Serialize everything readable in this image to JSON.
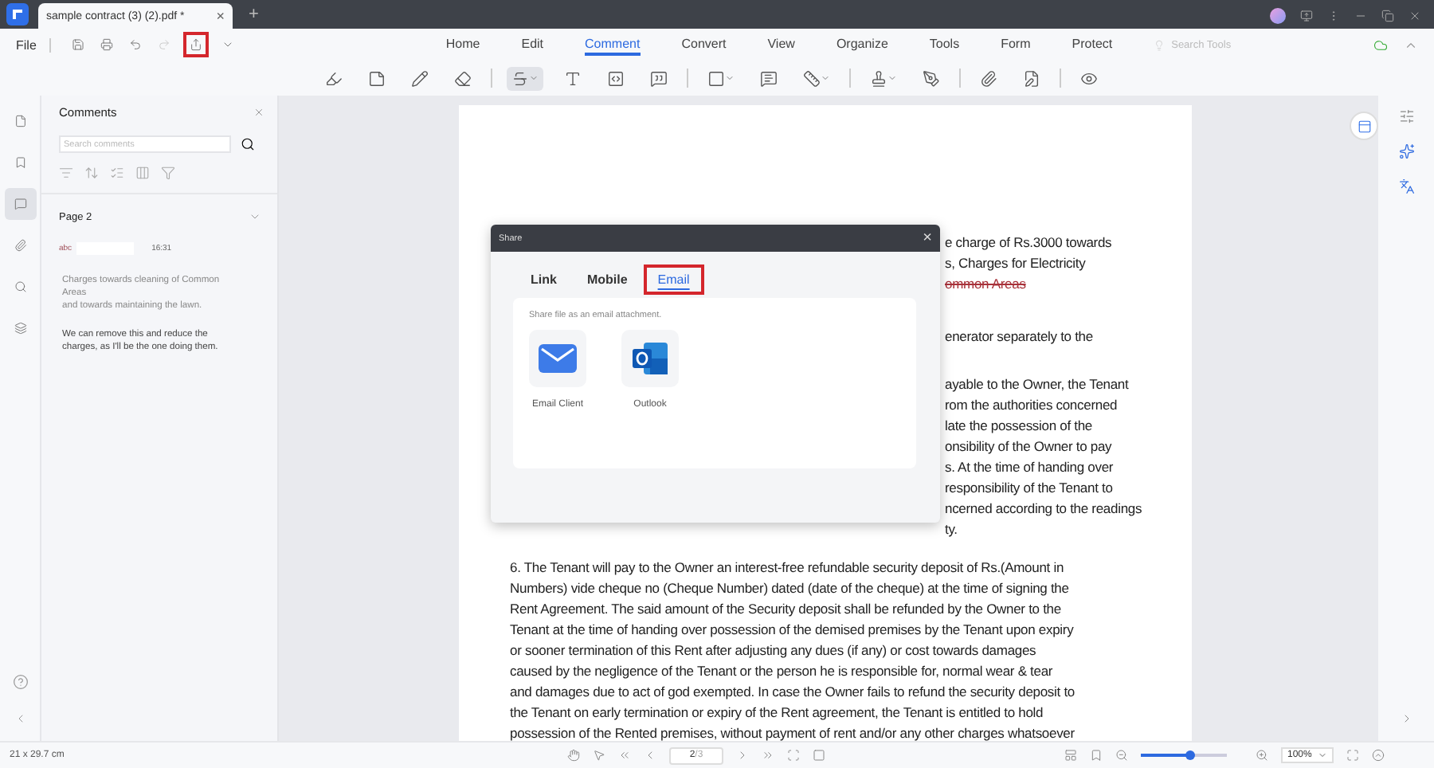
{
  "title_bar": {
    "tab": {
      "title": "sample contract (3) (2).pdf *",
      "close": "×"
    },
    "new_tab": "+"
  },
  "quick_access": {
    "file": "File",
    "share_highlighted": true
  },
  "nav_tabs": [
    {
      "label": "Home",
      "selected": false
    },
    {
      "label": "Edit",
      "selected": false
    },
    {
      "label": "Comment",
      "selected": true
    },
    {
      "label": "Convert",
      "selected": false
    },
    {
      "label": "View",
      "selected": false
    },
    {
      "label": "Organize",
      "selected": false
    },
    {
      "label": "Tools",
      "selected": false
    },
    {
      "label": "Form",
      "selected": false
    },
    {
      "label": "Protect",
      "selected": false
    }
  ],
  "search_tools": {
    "placeholder": "Search Tools"
  },
  "tools": [
    {
      "active": false
    },
    {
      "active": false
    },
    {
      "active": false
    },
    {
      "active": false
    },
    {
      "active": true
    },
    {
      "active": false
    },
    {
      "active": false
    },
    {
      "active": false
    },
    {
      "active": false
    },
    {
      "active": false
    },
    {
      "active": false
    },
    {
      "active": false
    },
    {
      "active": false
    },
    {
      "active": false
    },
    {
      "active": false
    },
    {
      "active": false
    }
  ],
  "left_rail": [
    {
      "selected": false
    },
    {
      "selected": false
    },
    {
      "selected": true
    },
    {
      "selected": false
    },
    {
      "selected": false
    },
    {
      "selected": false
    }
  ],
  "comments_panel": {
    "title": "Comments",
    "search": {
      "placeholder": "Search comments"
    },
    "group": {
      "label": "Page 2",
      "expanded": true
    },
    "comment": {
      "author": "abc",
      "time": "16:31",
      "quote": [
        "Charges towards cleaning of Common",
        "Areas",
        "and towards maintaining the lawn."
      ],
      "reply": [
        "We can remove this and reduce the",
        "charges, as I'll be the one doing them."
      ]
    }
  },
  "document": {
    "upper_paragraphs": [
      [
        {
          "text": "e charge of Rs.3000 towards",
          "kind": "plain"
        },
        {
          "text": "s, Charges for Electricity",
          "kind": "plain"
        },
        {
          "text": "ommon Areas",
          "kind": "strikethrough"
        }
      ],
      [
        {
          "text": "enerator separately to the",
          "kind": "plain"
        }
      ],
      [
        {
          "text": "ayable to the Owner, the Tenant",
          "kind": "plain"
        },
        {
          "text": "rom the authorities concerned",
          "kind": "plain"
        },
        {
          "text": "late the possession of the",
          "kind": "plain"
        },
        {
          "text": "onsibility of the Owner to pay",
          "kind": "plain"
        },
        {
          "text": "s. At the time of handing over",
          "kind": "plain"
        },
        {
          "text": "responsibility of the Tenant to",
          "kind": "plain"
        },
        {
          "text": "ncerned according to the readings",
          "kind": "plain"
        },
        {
          "text": "ty.",
          "kind": "plain"
        }
      ]
    ],
    "paragraph_6": [
      "6. The Tenant will pay to the Owner an interest-free refundable security deposit of Rs.(Amount in",
      "Numbers) vide cheque no (Cheque Number) dated (date of the cheque) at the time of signing the",
      "Rent Agreement. The said amount of the Security deposit shall be refunded by the Owner to the",
      "Tenant at the time of handing over possession of the demised premises by the Tenant upon expiry",
      "or sooner termination of this Rent after adjusting any dues (if any) or cost towards damages",
      "caused by the negligence of the Tenant or the person he is responsible for, normal wear & tear",
      "and damages due to act of god exempted. In case the Owner fails to refund the security deposit to",
      "the Tenant on early termination or expiry of the Rent agreement, the Tenant is entitled to hold",
      "possession of the Rented premises, without payment of rent and/or any other charges whatsoever"
    ]
  },
  "share_dialog": {
    "title": "Share",
    "close": "×",
    "tabs": [
      {
        "label": "Link",
        "selected": false,
        "highlighted": false
      },
      {
        "label": "Mobile",
        "selected": false,
        "highlighted": false
      },
      {
        "label": "Email",
        "selected": true,
        "highlighted": true
      }
    ],
    "hint": "Share file as an email attachment.",
    "options": [
      {
        "label": "Email Client",
        "kind": "mail"
      },
      {
        "label": "Outlook",
        "kind": "outlook"
      }
    ]
  },
  "status_bar": {
    "page_size": "21 x 29.7 cm",
    "page": "2",
    "page_total": "/3",
    "zoom": {
      "level": 0.58
    },
    "zoom_value": "100%"
  }
}
